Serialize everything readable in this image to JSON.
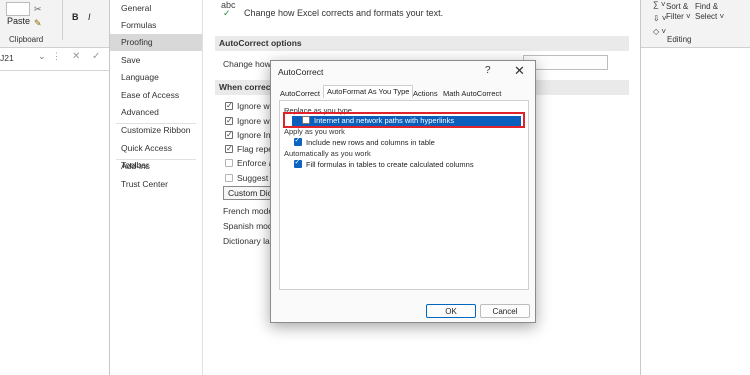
{
  "excel": {
    "ribbon_left": {
      "paste_label": "Paste",
      "bold": "B",
      "italic": "I",
      "clipboard_group": "Clipboard",
      "name_box": "J21"
    },
    "ribbon_right": {
      "sort_filter_label": "Sort &\nFilter ˅",
      "find_select_label": "Find &\nSelect ˅",
      "editing_group": "Editing"
    }
  },
  "options": {
    "nav": [
      {
        "label": "General",
        "active": false
      },
      {
        "label": "Formulas",
        "active": false
      },
      {
        "label": "Proofing",
        "active": true
      },
      {
        "label": "Save",
        "active": false
      },
      {
        "label": "Language",
        "active": false
      },
      {
        "label": "Ease of Access",
        "active": false
      },
      {
        "label": "Advanced",
        "active": false
      },
      {
        "label": "Customize Ribbon",
        "active": false
      },
      {
        "label": "Quick Access Toolbar",
        "active": false
      },
      {
        "label": "Add-ins",
        "active": false
      },
      {
        "label": "Trust Center",
        "active": false
      }
    ],
    "content": {
      "abc_icon_text": "abc",
      "intro": "Change how Excel corrects and formats your text.",
      "autocorrect_section": "AutoCorrect options",
      "autocorrect_row": "Change how E",
      "when_correcting_section": "When correctin",
      "options": [
        {
          "label": "Ignore wor",
          "checked": true
        },
        {
          "label": "Ignore wor",
          "checked": true
        },
        {
          "label": "Ignore Inte",
          "checked": true
        },
        {
          "label": "Flag repeat",
          "checked": true
        },
        {
          "label": "Enforce ac",
          "checked": false
        },
        {
          "label": "Suggest fro",
          "checked": false
        }
      ],
      "custom_dict_button": "Custom Dict",
      "french_modes": "French mode",
      "spanish_modes": "Spanish mode",
      "dictionary_lang": "Dictionary lan"
    }
  },
  "dialog": {
    "title": "AutoCorrect",
    "help": "?",
    "close": "✕",
    "tabs": [
      {
        "label": "AutoCorrect",
        "active": false
      },
      {
        "label": "AutoFormat As You Type",
        "active": true
      },
      {
        "label": "Actions",
        "active": false
      },
      {
        "label": "Math AutoCorrect",
        "active": false
      }
    ],
    "group_replace": "Replace as you type",
    "item_hyperlinks": "Internet and network paths with hyperlinks",
    "group_apply": "Apply as you work",
    "item_include_rows": "Include new rows and columns in table",
    "group_auto": "Automatically as you work",
    "item_fill_formulas": "Fill formulas in tables to create calculated columns",
    "ok": "OK",
    "cancel": "Cancel"
  },
  "colors": {
    "selection_blue": "#0a5fbd",
    "highlight_red": "#e0222b",
    "checkbox_blue": "#0b64c4"
  }
}
